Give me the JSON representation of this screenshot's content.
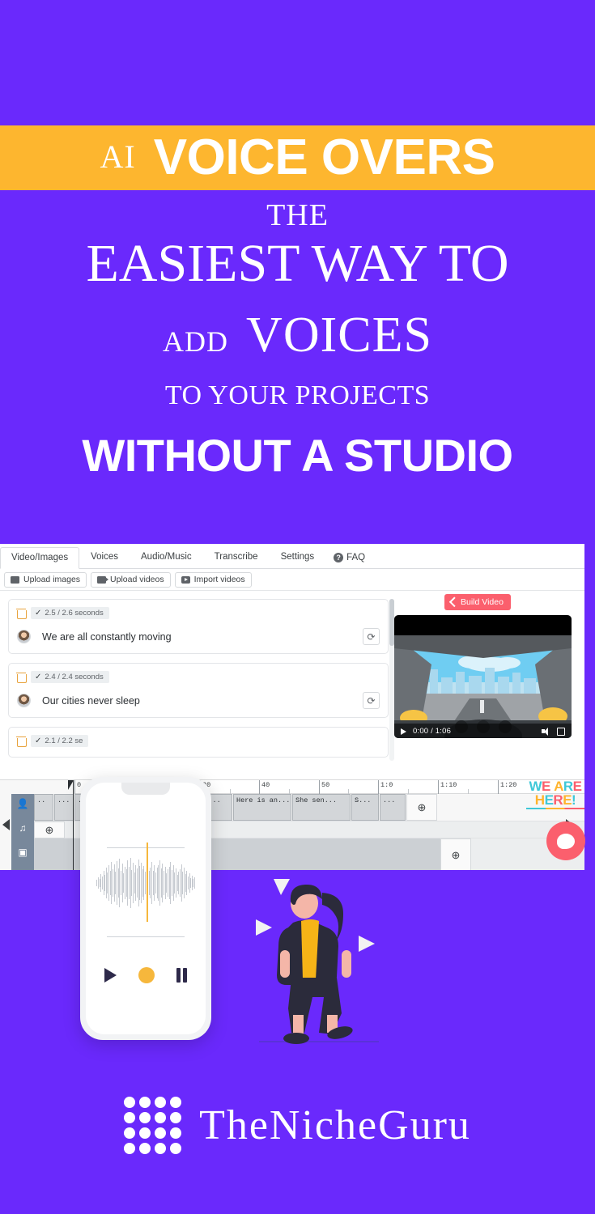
{
  "theme": {
    "purple": "#6a29fc",
    "amber": "#fdb62f",
    "coral": "#fb5f6d",
    "white": "#ffffff"
  },
  "banner": {
    "prefix": "AI",
    "title": "VOICE OVERS"
  },
  "headline": {
    "line1": "THE",
    "line2": "EASIEST WAY TO",
    "line3_small": "ADD",
    "line3_big": "VOICES",
    "line4": "TO YOUR PROJECTS",
    "line5": "WITHOUT A STUDIO"
  },
  "app": {
    "tabs": [
      {
        "label": "Video/Images",
        "active": true
      },
      {
        "label": "Voices",
        "active": false
      },
      {
        "label": "Audio/Music",
        "active": false
      },
      {
        "label": "Transcribe",
        "active": false
      },
      {
        "label": "Settings",
        "active": false
      }
    ],
    "faq": {
      "label": "FAQ",
      "badge": "?"
    },
    "upload_buttons": [
      {
        "label": "Upload images",
        "icon": "image-icon"
      },
      {
        "label": "Upload videos",
        "icon": "video-camera-icon"
      },
      {
        "label": "Import videos",
        "icon": "youtube-icon"
      }
    ],
    "cards": [
      {
        "duration": "2.5 / 2.6 seconds",
        "text": "We are all constantly moving"
      },
      {
        "duration": "2.4 / 2.4 seconds",
        "text": "Our cities never sleep"
      },
      {
        "duration": "2.1 / 2.2 se",
        "text": ""
      }
    ],
    "preview": {
      "build_label": "Build Video",
      "time": "0:00 / 1:06"
    }
  },
  "timeline": {
    "ticks": [
      "0",
      "30",
      "40",
      "50",
      "1:0",
      "1:10",
      "1:20"
    ],
    "clips": [
      "..",
      "...",
      "...",
      "...",
      "..",
      "All ...",
      "Here is an...",
      "She sen...",
      "S...",
      "..."
    ],
    "add_label": "+",
    "tracks": [
      "voice-track",
      "music-track",
      "media-track"
    ]
  },
  "badge": {
    "line1": "WE ARE",
    "line2": "HERE!"
  },
  "phone": {
    "play": "play-button",
    "record": "record-button",
    "pause": "pause-button"
  },
  "footer": {
    "brand": "TheNicheGuru"
  }
}
